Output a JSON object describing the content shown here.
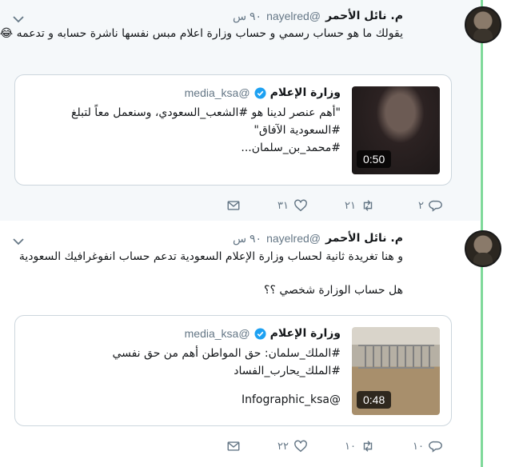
{
  "tweets": [
    {
      "name": "م. نائل الأحمر",
      "handle": "@nayelred",
      "time": "٩٠ س",
      "text": "يقولك ما هو حساب رسمي و حساب وزارة اعلام مبس نفسها ناشرة حسابه و تدعمه 😂😂",
      "card": {
        "name": "وزارة الإعلام",
        "handle": "@media_ksa",
        "lines": [
          "\"أهم عنصر لدينا هو #الشعب_السعودي، وسنعمل معاً لتبلغ",
          "#السعودية الآفاق\"",
          "#محمد_بن_سلمان..."
        ],
        "duration": "0:50"
      },
      "actions": {
        "replies": "٢",
        "retweets": "٢١",
        "likes": "٣١"
      }
    },
    {
      "name": "م. نائل الأحمر",
      "handle": "@nayelred",
      "time": "٩٠ س",
      "text": "و هنا تغريدة ثانية لحساب وزارة الإعلام السعودية تدعم حساب انفوغرافيك السعودية",
      "text2": "هل حساب الوزارة شخصي ؟؟",
      "card": {
        "name": "وزارة الإعلام",
        "handle": "@media_ksa",
        "lines": [
          "#الملك_سلمان: حق المواطن أهم من حق نفسي",
          "#الملك_يحارب_الفساد"
        ],
        "mention": "@Infographic_ksa",
        "duration": "0:48"
      },
      "actions": {
        "replies": "١٠",
        "retweets": "١٠",
        "likes": "٢٢"
      }
    }
  ],
  "icons": [
    "reply-icon",
    "retweet-icon",
    "like-icon",
    "message-icon",
    "verified-icon",
    "chevron-down-icon"
  ],
  "colors": {
    "thread_line": "#7fd99a",
    "verified": "#1da1f2",
    "muted": "#657786"
  }
}
